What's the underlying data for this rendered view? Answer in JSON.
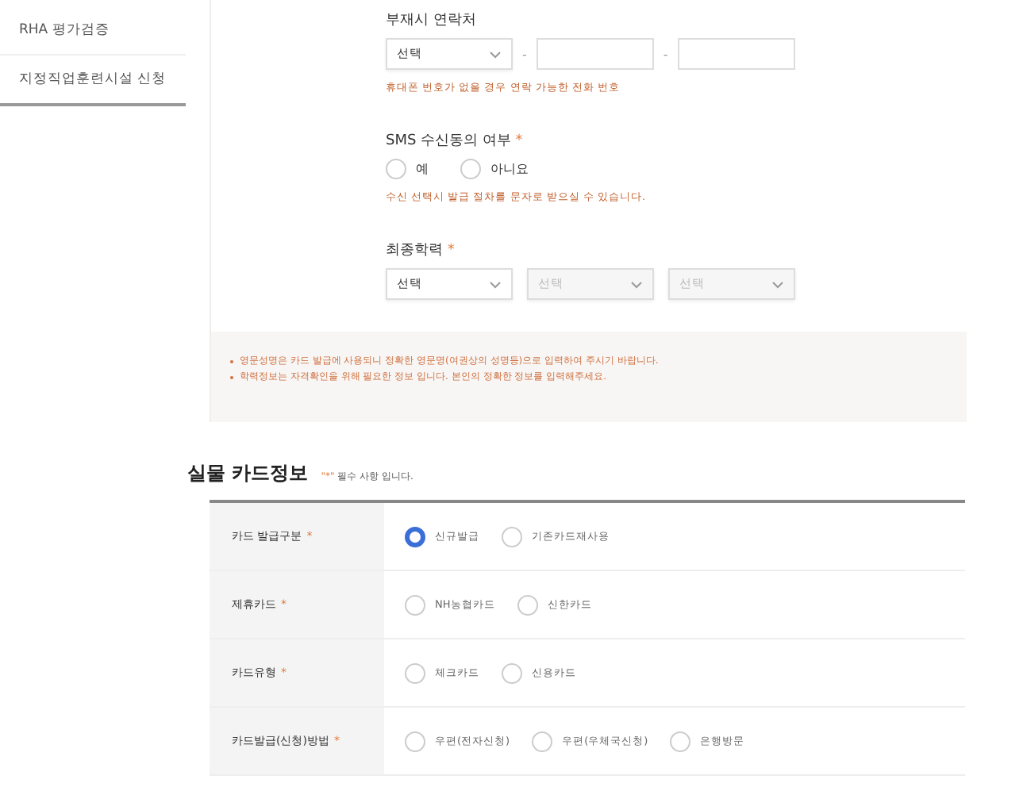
{
  "sidebar": {
    "items": [
      {
        "label": "RHA 평가검증",
        "selected": false
      },
      {
        "label": "지정직업훈련시설 신청",
        "selected": true
      }
    ]
  },
  "contact": {
    "label": "부재시 연락처",
    "select": "선택",
    "separators": [
      "-",
      "-"
    ],
    "help": "휴대폰 번호가 없을 경우 연락 가능한 전화 번호"
  },
  "sms": {
    "label": "SMS 수신동의 여부",
    "required": "*",
    "options": [
      {
        "label": "예",
        "selected": false
      },
      {
        "label": "아니요",
        "selected": false
      }
    ],
    "help": "수신 선택시 발급 절차를 문자로 받으실 수 있습니다."
  },
  "education": {
    "label": "최종학력",
    "required": "*",
    "selects": [
      {
        "value": "선택",
        "disabled": false
      },
      {
        "value": "선택",
        "disabled": true
      },
      {
        "value": "선택",
        "disabled": true
      }
    ]
  },
  "notices": [
    "영문성명은 카드 발급에 사용되니 정확한 영문명(여권상의 성명등)으로 입력하여 주시기 바랍니다.",
    "학력정보는 자격확인을 위해 필요한 정보 입니다. 본인의 정확한 정보를 입력해주세요."
  ],
  "card_section": {
    "title": "실물 카드정보",
    "note_mark": "\"*\"",
    "note": "필수 사항 입니다.",
    "rows": [
      {
        "label": "카드 발급구분",
        "required": "*",
        "options": [
          {
            "label": "신규발급",
            "selected": true
          },
          {
            "label": "기존카드재사용",
            "selected": false
          }
        ]
      },
      {
        "label": "제휴카드",
        "required": "*",
        "options": [
          {
            "label": "NH농협카드",
            "selected": false
          },
          {
            "label": "신한카드",
            "selected": false
          }
        ]
      },
      {
        "label": "카드유형",
        "required": "*",
        "options": [
          {
            "label": "체크카드",
            "selected": false
          },
          {
            "label": "신용카드",
            "selected": false
          }
        ]
      },
      {
        "label": "카드발급(신청)방법",
        "required": "*",
        "options": [
          {
            "label": "우편(전자신청)",
            "selected": false
          },
          {
            "label": "우편(우체국신청)",
            "selected": false
          },
          {
            "label": "은행방문",
            "selected": false
          }
        ]
      }
    ]
  }
}
